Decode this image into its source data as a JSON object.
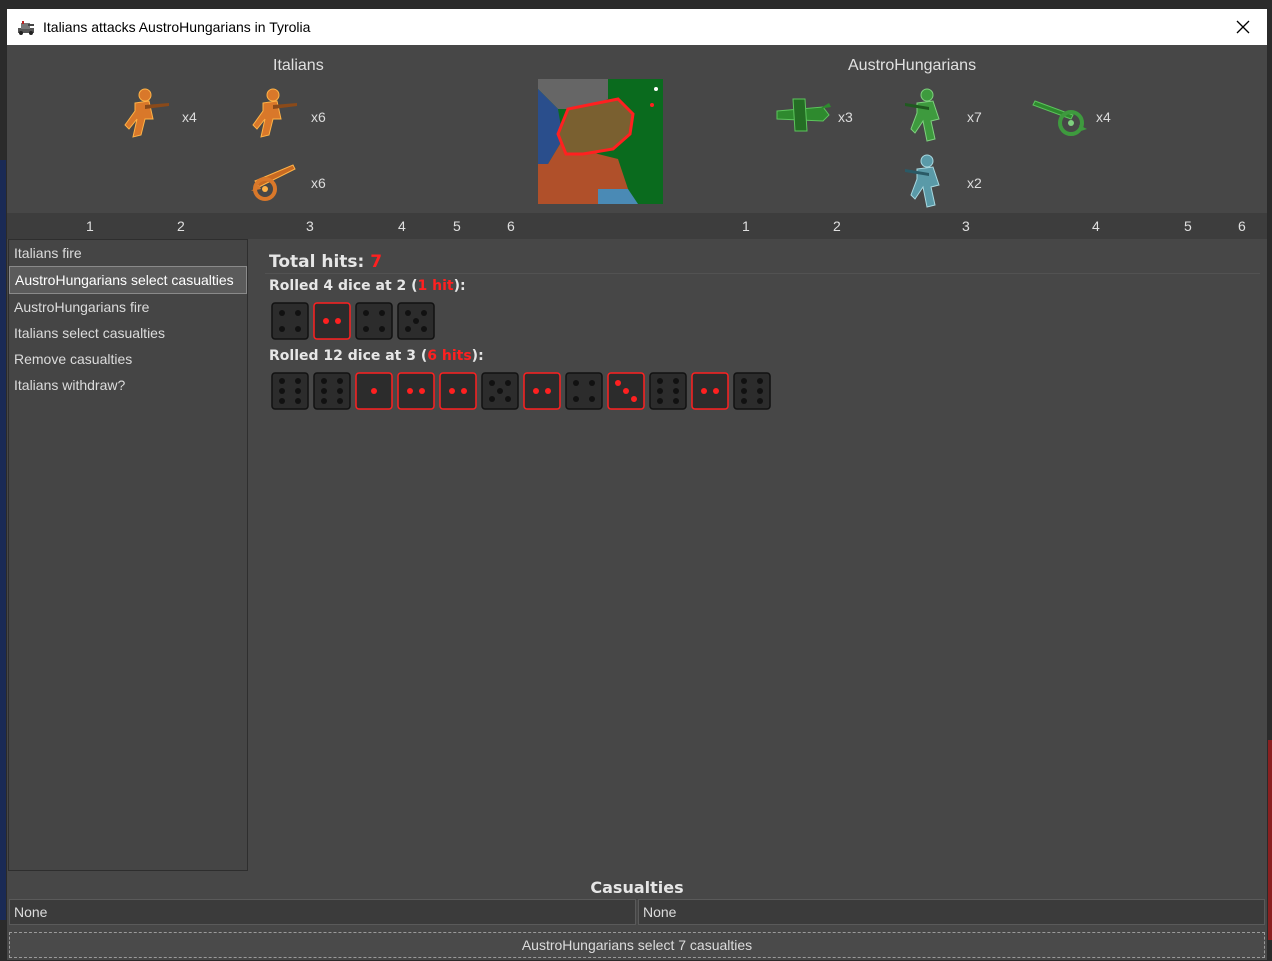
{
  "window": {
    "title": "Italians attacks AustroHungarians in Tyrolia"
  },
  "attacker": {
    "name": "Italians",
    "units": [
      {
        "icon": "italian-infantry-icon",
        "count": "x4"
      },
      {
        "icon": "italian-infantry-icon",
        "count": "x6"
      },
      {
        "icon": "italian-artillery-icon",
        "count": "x6"
      }
    ],
    "columns": [
      "1",
      "2",
      "3",
      "4",
      "5",
      "6"
    ]
  },
  "defender": {
    "name": "AustroHungarians",
    "units": [
      {
        "icon": "austro-aircraft-icon",
        "count": "x3"
      },
      {
        "icon": "austro-infantry-icon",
        "count": "x7"
      },
      {
        "icon": "austro-artillery-icon",
        "count": "x4"
      },
      {
        "icon": "austro-elite-infantry-icon",
        "count": "x2"
      }
    ],
    "columns": [
      "1",
      "2",
      "3",
      "4",
      "5",
      "6"
    ]
  },
  "steps": [
    {
      "label": "Italians fire",
      "selected": false
    },
    {
      "label": "AustroHungarians select casualties",
      "selected": true
    },
    {
      "label": "AustroHungarians fire",
      "selected": false
    },
    {
      "label": "Italians select casualties",
      "selected": false
    },
    {
      "label": "Remove casualties",
      "selected": false
    },
    {
      "label": "Italians withdraw?",
      "selected": false
    }
  ],
  "results": {
    "total_label": "Total hits: ",
    "total_value": "7",
    "rolls": [
      {
        "prefix": "Rolled 4 dice at 2 (",
        "hits": "1 hit",
        "suffix": "):",
        "dice": [
          {
            "value": 4,
            "hit": false
          },
          {
            "value": 2,
            "hit": true
          },
          {
            "value": 4,
            "hit": false
          },
          {
            "value": 5,
            "hit": false
          }
        ]
      },
      {
        "prefix": "Rolled 12 dice at 3 (",
        "hits": "6 hits",
        "suffix": "):",
        "dice": [
          {
            "value": 6,
            "hit": false
          },
          {
            "value": 6,
            "hit": false
          },
          {
            "value": 1,
            "hit": true
          },
          {
            "value": 2,
            "hit": true
          },
          {
            "value": 2,
            "hit": true
          },
          {
            "value": 5,
            "hit": false
          },
          {
            "value": 2,
            "hit": true
          },
          {
            "value": 4,
            "hit": false
          },
          {
            "value": 3,
            "hit": true
          },
          {
            "value": 6,
            "hit": false
          },
          {
            "value": 2,
            "hit": true
          },
          {
            "value": 6,
            "hit": false
          }
        ]
      }
    ]
  },
  "casualties": {
    "title": "Casualties",
    "attacker": "None",
    "defender": "None"
  },
  "action_button": {
    "label": "AustroHungarians select 7 casualties"
  },
  "colors": {
    "hit": "#ff2020",
    "background": "#474747",
    "italian": "#d9782a",
    "austro": "#3e9a3e",
    "austro_elite": "#5a9aa8"
  }
}
